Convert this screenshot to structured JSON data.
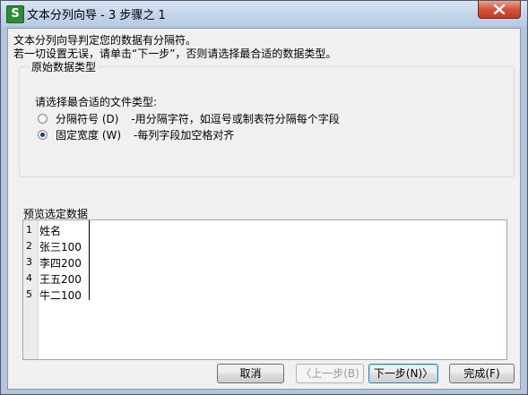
{
  "window": {
    "title": "文本分列向导 - 3 步骤之 1",
    "app_icon_letter": "S",
    "accent_color": "#2f8a34"
  },
  "intro": {
    "line1": "文本分列向导判定您的数据有分隔符。",
    "line2": "若一切设置无误，请单击“下一步”，否则请选择最合适的数据类型。"
  },
  "group": {
    "legend": "原始数据类型",
    "prompt": "请选择最合适的文件类型:",
    "options": [
      {
        "label": "分隔符号 (D)",
        "desc": "-用分隔字符，如逗号或制表符分隔每个字段",
        "checked": false
      },
      {
        "label": "固定宽度 (W)",
        "desc": "-每列字段加空格对齐",
        "checked": true
      }
    ]
  },
  "preview": {
    "label": "预览选定数据",
    "rows": [
      {
        "num": "1",
        "value": "姓名"
      },
      {
        "num": "2",
        "value": "张三100"
      },
      {
        "num": "3",
        "value": "李四200"
      },
      {
        "num": "4",
        "value": "王五200"
      },
      {
        "num": "5",
        "value": "牛二100"
      }
    ]
  },
  "buttons": {
    "cancel": "取消",
    "back": "〈上一步(B)",
    "next": "下一步(N)〉",
    "finish": "完成(F)"
  }
}
